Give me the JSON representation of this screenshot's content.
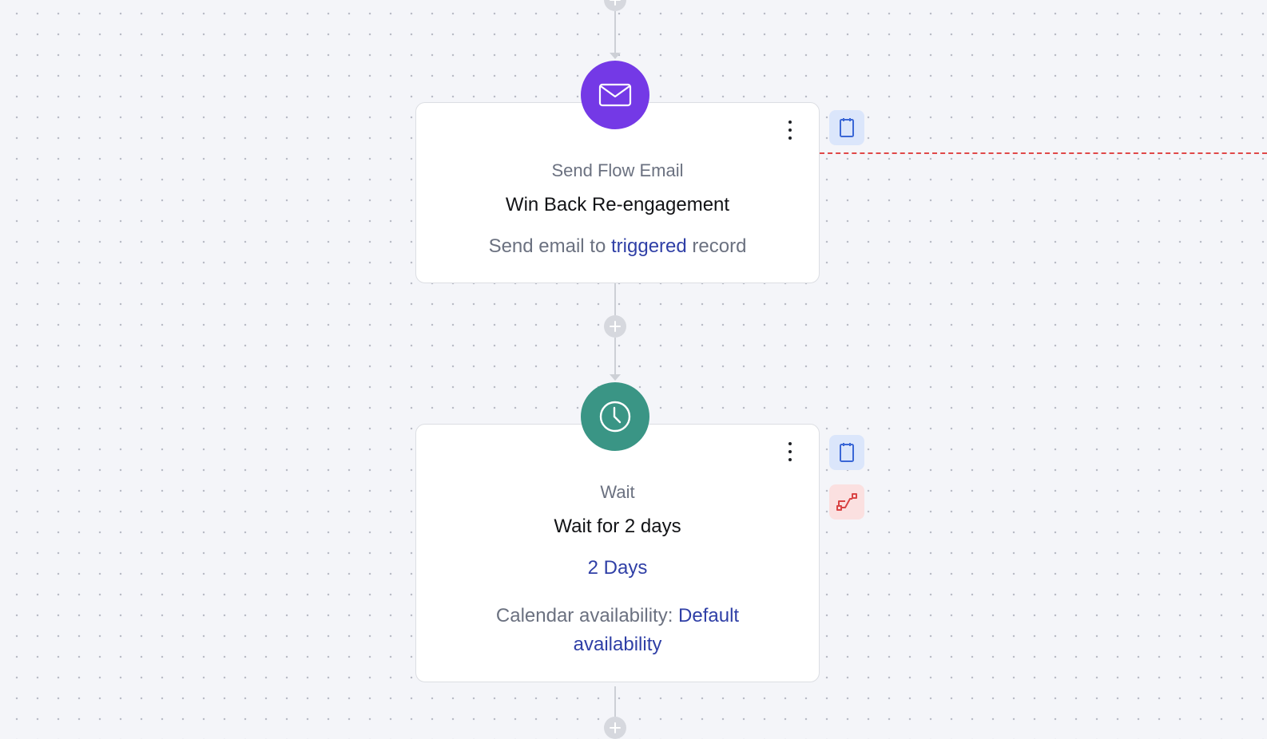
{
  "nodes": {
    "email": {
      "icon": "envelope-icon",
      "icon_color": "#7439e6",
      "type_label": "Send Flow Email",
      "title": "Win Back Re-engagement",
      "detail_prefix": "Send email to",
      "detail_link": "triggered",
      "detail_suffix": "record"
    },
    "wait": {
      "icon": "clock-icon",
      "icon_color": "#3a9585",
      "type_label": "Wait",
      "title": "Wait for 2 days",
      "duration": "2 Days",
      "availability_label": "Calendar availability:",
      "availability_link_line1": "Default",
      "availability_link_line2": "availability"
    }
  },
  "side_actions": {
    "email_panel_icon": "notepad-icon",
    "wait_panel_icon": "notepad-icon",
    "wait_branch_icon": "branch-icon"
  },
  "colors": {
    "link": "#2f3fa6",
    "dashed_line": "#e04848",
    "side_blue_bg": "#dbe6fb",
    "side_red_bg": "#fbe0e0"
  }
}
